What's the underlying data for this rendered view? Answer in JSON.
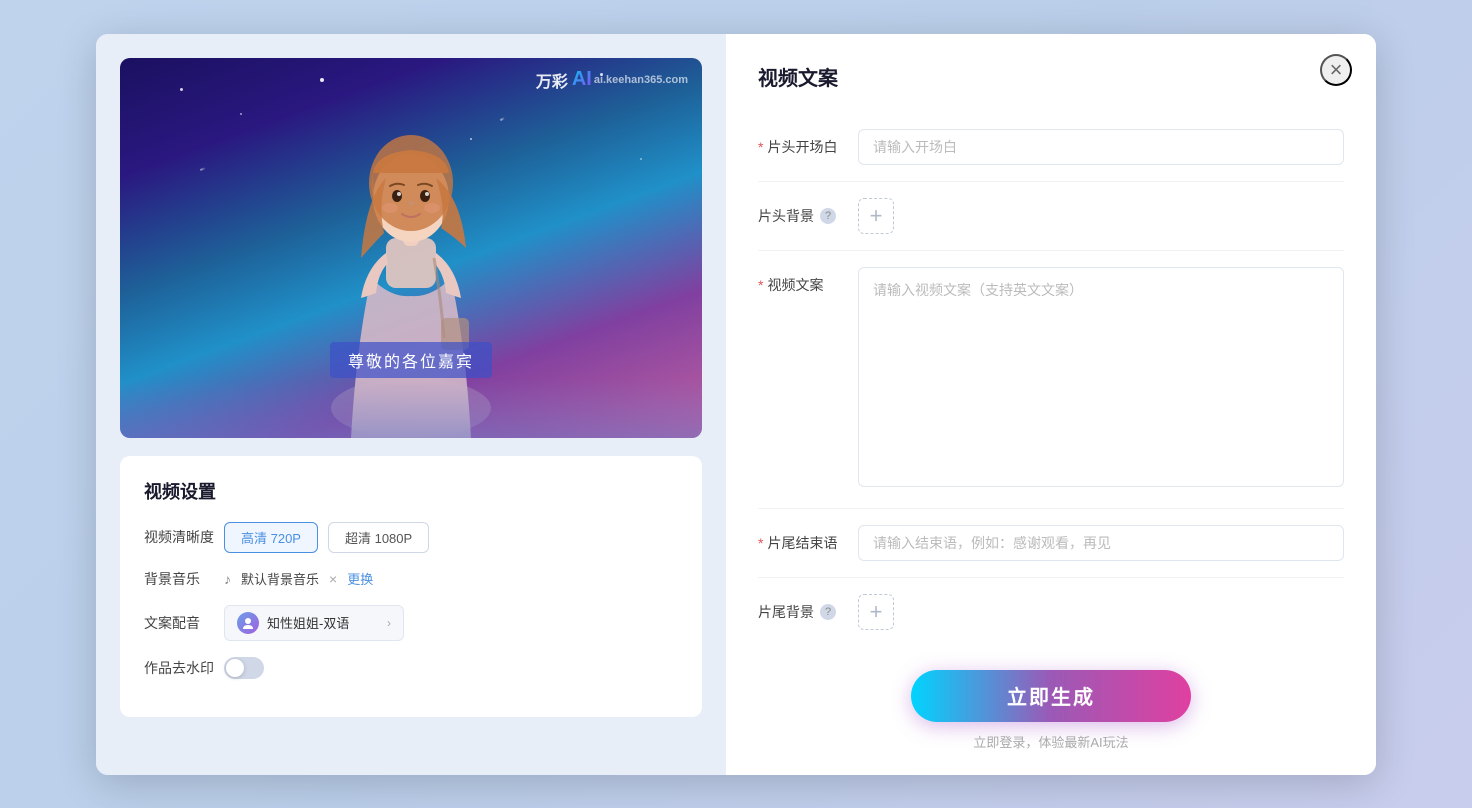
{
  "modal": {
    "close_label": "×"
  },
  "right_panel": {
    "title": "视频文案",
    "fields": {
      "opening": {
        "label": "片头开场白",
        "placeholder": "请输入开场白"
      },
      "header_bg": {
        "label": "片头背景"
      },
      "video_copy": {
        "label": "视频文案",
        "placeholder": "请输入视频文案（支持英文文案）"
      },
      "ending": {
        "label": "片尾结束语",
        "placeholder": "请输入结束语，例如：感谢观看，再见"
      },
      "footer_bg": {
        "label": "片尾背景"
      }
    },
    "generate_btn": "立即生成",
    "generate_hint": "立即登录，体验最新AI玩法"
  },
  "left_panel": {
    "settings_title": "视频设置",
    "subtitle": "尊敬的各位嘉宾",
    "watermark_text": "万彩",
    "watermark_ai": "AI",
    "watermark_sub": "ai.keehan365.com",
    "quality_label": "视频清晰度",
    "quality_options": [
      {
        "label": "高清 720P",
        "active": true
      },
      {
        "label": "超清 1080P",
        "active": false
      }
    ],
    "music_label": "背景音乐",
    "music_name": "默认背景音乐",
    "music_change": "更换",
    "voice_label": "文案配音",
    "voice_name": "知性姐姐-双语",
    "watermark_label": "作品去水印"
  }
}
